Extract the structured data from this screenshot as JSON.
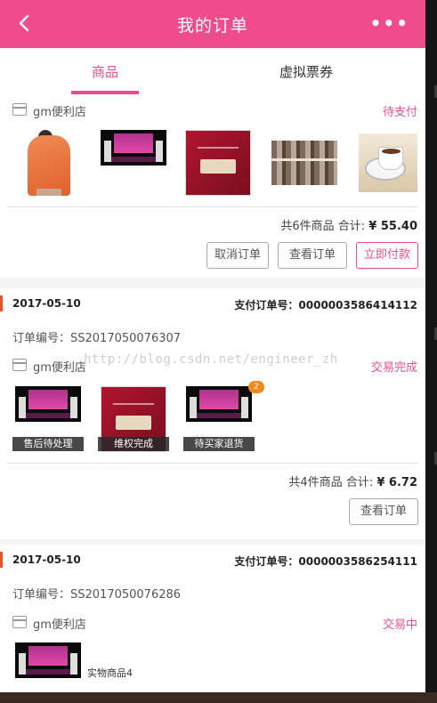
{
  "header": {
    "title": "我的订单",
    "back_icon": "chevron-left-icon",
    "more_label": "•••"
  },
  "tabs": [
    {
      "label": "商品",
      "active": true
    },
    {
      "label": "虚拟票券",
      "active": false
    }
  ],
  "colors": {
    "accent": "#f04b8b",
    "date_marker": "#e8502c",
    "badge": "#f08a1a"
  },
  "orders": [
    {
      "store": "gm便利店",
      "status": "待支付",
      "summary_prefix": "共6件商品 合计: ",
      "total": "¥ 55.40",
      "buttons": [
        "取消订单",
        "查看订单",
        "立即付款"
      ]
    },
    {
      "date": "2017-05-10",
      "pay_no": "支付订单号：0000003586414112",
      "order_no": "订单编号：SS2017050076307",
      "store": "gm便利店",
      "status": "交易完成",
      "captions": [
        "售后待处理",
        "维权完成",
        "待买家退货"
      ],
      "badge": "2",
      "summary_prefix": "共4件商品 合计: ",
      "total": "¥ 6.72",
      "buttons": [
        "查看订单"
      ]
    },
    {
      "date": "2017-05-10",
      "pay_no": "支付订单号：0000003586254111",
      "order_no": "订单编号：SS2017050076286",
      "store": "gm便利店",
      "status": "交易中",
      "item_name": "实物商品4"
    }
  ],
  "watermark": "http://blog.csdn.net/engineer_zh"
}
